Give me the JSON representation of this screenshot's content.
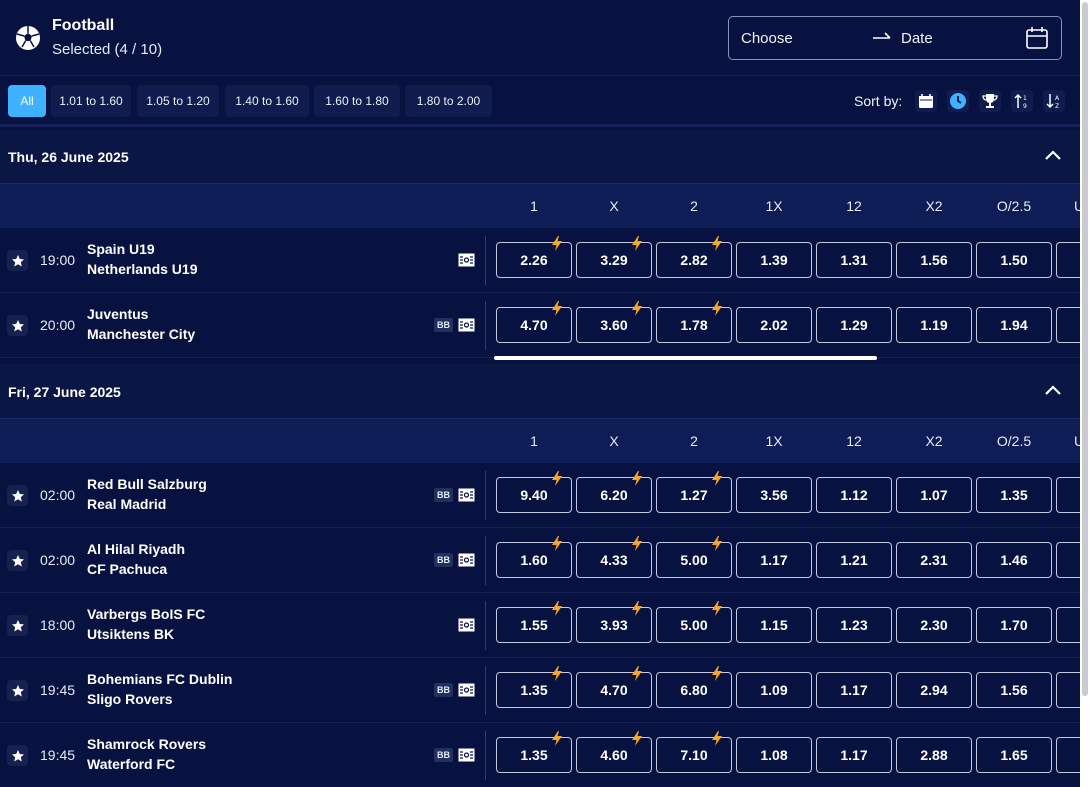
{
  "header": {
    "sport": "Football",
    "selected": "Selected (4 / 10)",
    "date_from": "Choose",
    "date_to": "Date"
  },
  "filters": [
    "All",
    "1.01 to 1.60",
    "1.05 to 1.20",
    "1.40 to 1.60",
    "1.60 to 1.80",
    "1.80 to 2.00"
  ],
  "sort": {
    "label": "Sort by:",
    "icons": [
      "calendar-icon",
      "clock-icon",
      "trophy-icon",
      "sort-numeric-asc-icon",
      "sort-alpha-desc-icon"
    ]
  },
  "columns": [
    "1",
    "X",
    "2",
    "1X",
    "12",
    "X2",
    "O/2.5"
  ],
  "days": [
    {
      "title": "Thu, 26 June 2025",
      "matches": [
        {
          "time": "19:00",
          "home": "Spain U19",
          "away": "Netherlands U19",
          "bb": false,
          "odds": [
            "2.26",
            "3.29",
            "2.82",
            "1.39",
            "1.31",
            "1.56",
            "1.50"
          ]
        },
        {
          "time": "20:00",
          "home": "Juventus",
          "away": "Manchester City",
          "bb": true,
          "odds": [
            "4.70",
            "3.60",
            "1.78",
            "2.02",
            "1.29",
            "1.19",
            "1.94"
          ]
        }
      ]
    },
    {
      "title": "Fri, 27 June 2025",
      "matches": [
        {
          "time": "02:00",
          "home": "Red Bull Salzburg",
          "away": "Real Madrid",
          "bb": true,
          "odds": [
            "9.40",
            "6.20",
            "1.27",
            "3.56",
            "1.12",
            "1.07",
            "1.35"
          ]
        },
        {
          "time": "02:00",
          "home": "Al Hilal Riyadh",
          "away": "CF Pachuca",
          "bb": true,
          "odds": [
            "1.60",
            "4.33",
            "5.00",
            "1.17",
            "1.21",
            "2.31",
            "1.46"
          ]
        },
        {
          "time": "18:00",
          "home": "Varbergs BoIS FC",
          "away": "Utsiktens BK",
          "bb": false,
          "odds": [
            "1.55",
            "3.93",
            "5.00",
            "1.15",
            "1.23",
            "2.30",
            "1.70"
          ]
        },
        {
          "time": "19:45",
          "home": "Bohemians FC Dublin",
          "away": "Sligo Rovers",
          "bb": true,
          "odds": [
            "1.35",
            "4.70",
            "6.80",
            "1.09",
            "1.17",
            "2.94",
            "1.56"
          ]
        },
        {
          "time": "19:45",
          "home": "Shamrock Rovers",
          "away": "Waterford FC",
          "bb": true,
          "odds": [
            "1.35",
            "4.60",
            "7.10",
            "1.08",
            "1.17",
            "2.88",
            "1.65"
          ]
        }
      ]
    }
  ],
  "bb_label": "BB",
  "colors": {
    "background": "#071240",
    "accent": "#3fb2ff",
    "boost": "#f5a623"
  }
}
